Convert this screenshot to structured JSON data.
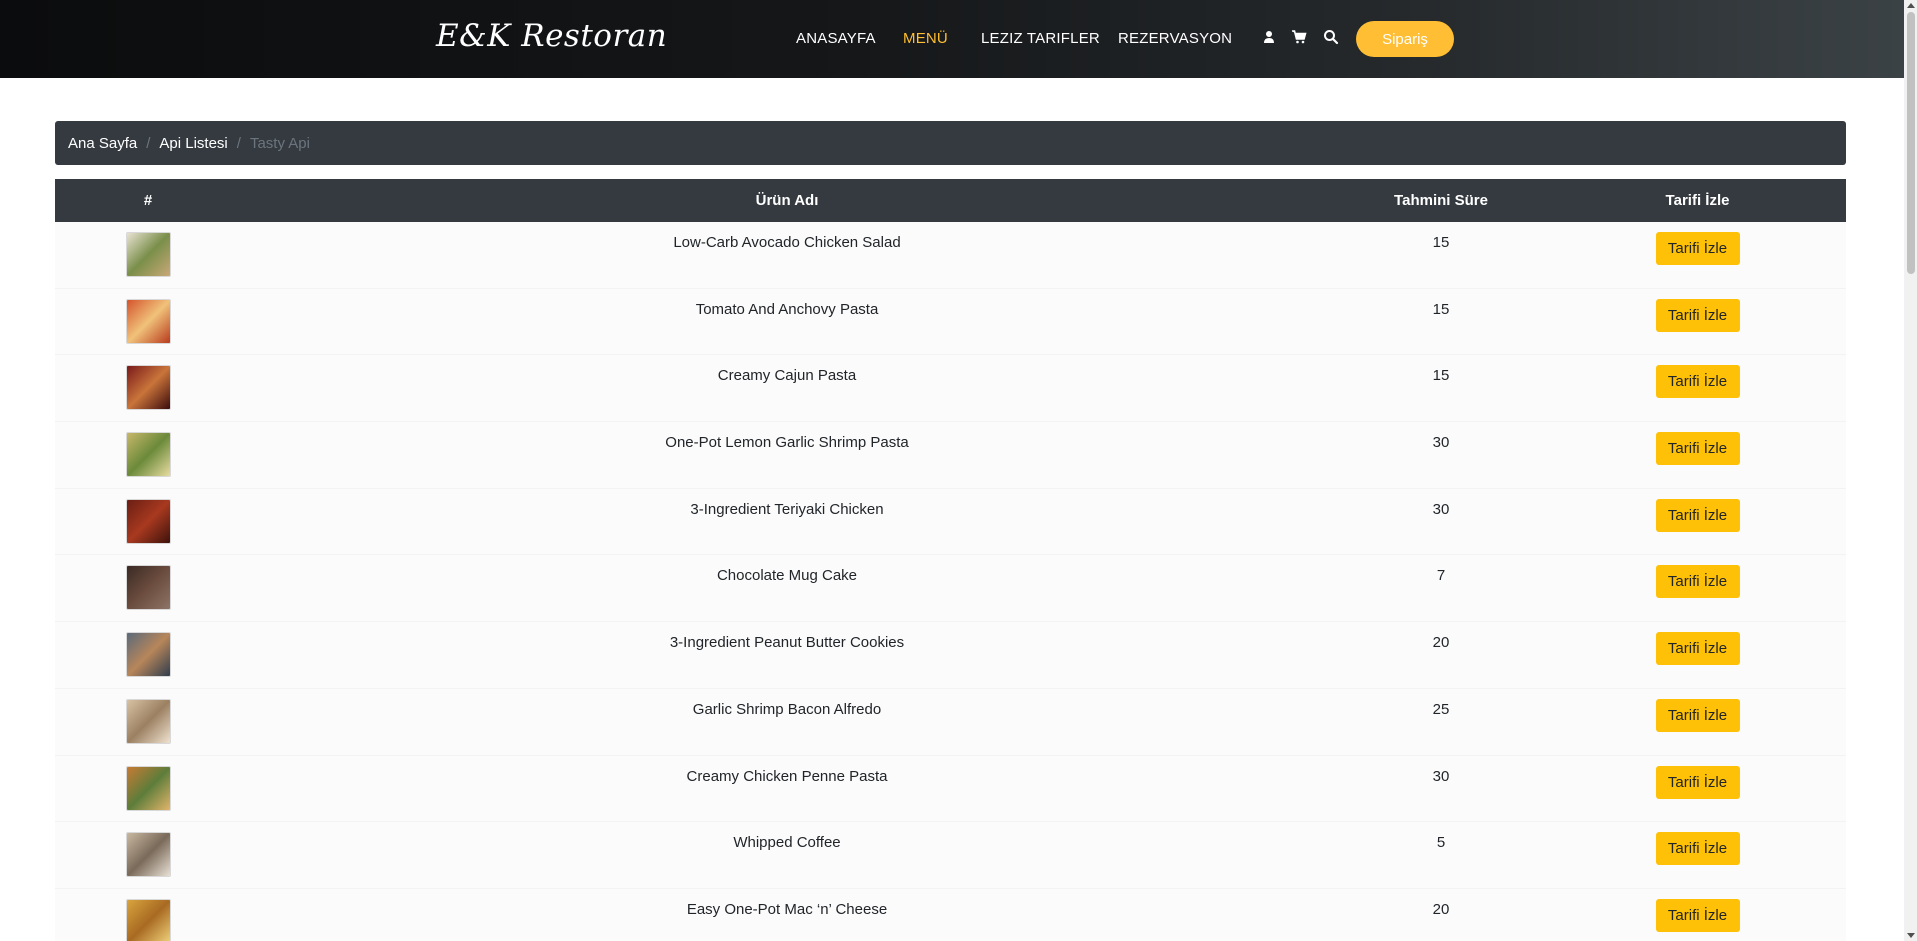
{
  "header": {
    "brand": "E&K Restoran",
    "nav": [
      {
        "label": "ANASAYFA",
        "active": false
      },
      {
        "label": "MENÜ",
        "active": true
      },
      {
        "label": "LEZIZ TARIFLER",
        "active": false
      },
      {
        "label": "REZERVASYON",
        "active": false
      }
    ],
    "icons": [
      "user-icon",
      "cart-icon",
      "search-icon"
    ],
    "order_button": "Sipariş"
  },
  "breadcrumb": {
    "items": [
      "Ana Sayfa",
      "Api Listesi"
    ],
    "active": "Tasty Api"
  },
  "table": {
    "headers": [
      "#",
      "Ürün Adı",
      "Tahmini Süre",
      "Tarifi İzle"
    ],
    "rows": [
      {
        "name": "Low-Carb Avocado Chicken Salad",
        "time": "15",
        "action": "Tarifi İzle"
      },
      {
        "name": "Tomato And Anchovy Pasta",
        "time": "15",
        "action": "Tarifi İzle"
      },
      {
        "name": "Creamy Cajun Pasta",
        "time": "15",
        "action": "Tarifi İzle"
      },
      {
        "name": "One-Pot Lemon Garlic Shrimp Pasta",
        "time": "30",
        "action": "Tarifi İzle"
      },
      {
        "name": "3-Ingredient Teriyaki Chicken",
        "time": "30",
        "action": "Tarifi İzle"
      },
      {
        "name": "Chocolate Mug Cake",
        "time": "7",
        "action": "Tarifi İzle"
      },
      {
        "name": "3-Ingredient Peanut Butter Cookies",
        "time": "20",
        "action": "Tarifi İzle"
      },
      {
        "name": "Garlic Shrimp Bacon Alfredo",
        "time": "25",
        "action": "Tarifi İzle"
      },
      {
        "name": "Creamy Chicken Penne Pasta",
        "time": "30",
        "action": "Tarifi İzle"
      },
      {
        "name": "Whipped Coffee",
        "time": "5",
        "action": "Tarifi İzle"
      },
      {
        "name": "Easy One-Pot Mac ‘n’ Cheese",
        "time": "20",
        "action": "Tarifi İzle"
      }
    ]
  },
  "colors": {
    "accent": "#ffbe33",
    "button": "#ffc107",
    "dark": "#343a40"
  }
}
